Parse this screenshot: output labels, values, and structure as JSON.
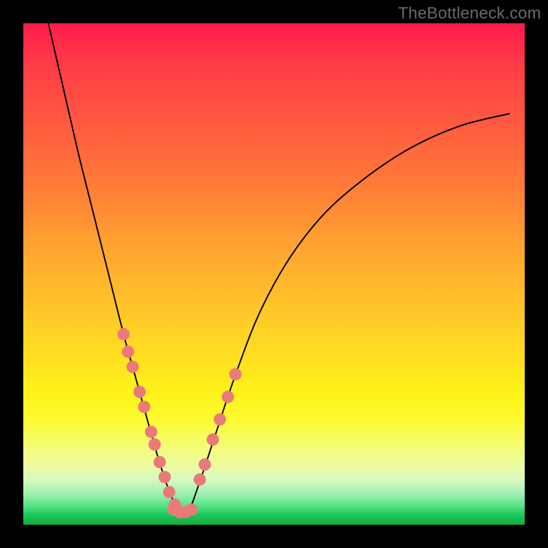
{
  "watermark": "TheBottleneck.com",
  "chart_data": {
    "type": "line",
    "title": "",
    "xlabel": "",
    "ylabel": "",
    "xlim": [
      0,
      1
    ],
    "ylim": [
      0,
      1
    ],
    "grid": false,
    "legend": false,
    "annotations": [],
    "series": [
      {
        "name": "bottleneck-curve",
        "color": "#000000",
        "x": [
          0.05,
          0.08,
          0.11,
          0.14,
          0.17,
          0.2,
          0.225,
          0.25,
          0.27,
          0.29,
          0.31,
          0.33,
          0.35,
          0.38,
          0.42,
          0.47,
          0.53,
          0.6,
          0.68,
          0.77,
          0.87,
          0.97
        ],
        "y": [
          1.0,
          0.87,
          0.74,
          0.62,
          0.5,
          0.38,
          0.29,
          0.2,
          0.13,
          0.07,
          0.03,
          0.03,
          0.08,
          0.17,
          0.29,
          0.42,
          0.53,
          0.62,
          0.69,
          0.75,
          0.795,
          0.82
        ]
      },
      {
        "name": "markers-left",
        "color": "#ea7a7a",
        "type": "scatter",
        "x": [
          0.2,
          0.209,
          0.218,
          0.232,
          0.241,
          0.255,
          0.262,
          0.272,
          0.282,
          0.291,
          0.302
        ],
        "y": [
          0.38,
          0.345,
          0.315,
          0.265,
          0.235,
          0.185,
          0.16,
          0.125,
          0.095,
          0.065,
          0.04
        ]
      },
      {
        "name": "markers-bottom",
        "color": "#ea7a7a",
        "type": "scatter",
        "x": [
          0.3,
          0.312,
          0.323,
          0.335
        ],
        "y": [
          0.03,
          0.025,
          0.025,
          0.03
        ]
      },
      {
        "name": "markers-right",
        "color": "#ea7a7a",
        "type": "scatter",
        "x": [
          0.352,
          0.362,
          0.378,
          0.392,
          0.408,
          0.423
        ],
        "y": [
          0.09,
          0.12,
          0.17,
          0.21,
          0.255,
          0.3
        ]
      }
    ],
    "gradient_stops": [
      {
        "pos": 0.0,
        "color": "#ff1b4a"
      },
      {
        "pos": 0.2,
        "color": "#ff5a40"
      },
      {
        "pos": 0.45,
        "color": "#ffa530"
      },
      {
        "pos": 0.67,
        "color": "#ffe020"
      },
      {
        "pos": 0.83,
        "color": "#f6fc6a"
      },
      {
        "pos": 0.94,
        "color": "#9af0b0"
      },
      {
        "pos": 1.0,
        "color": "#0fae40"
      }
    ]
  }
}
